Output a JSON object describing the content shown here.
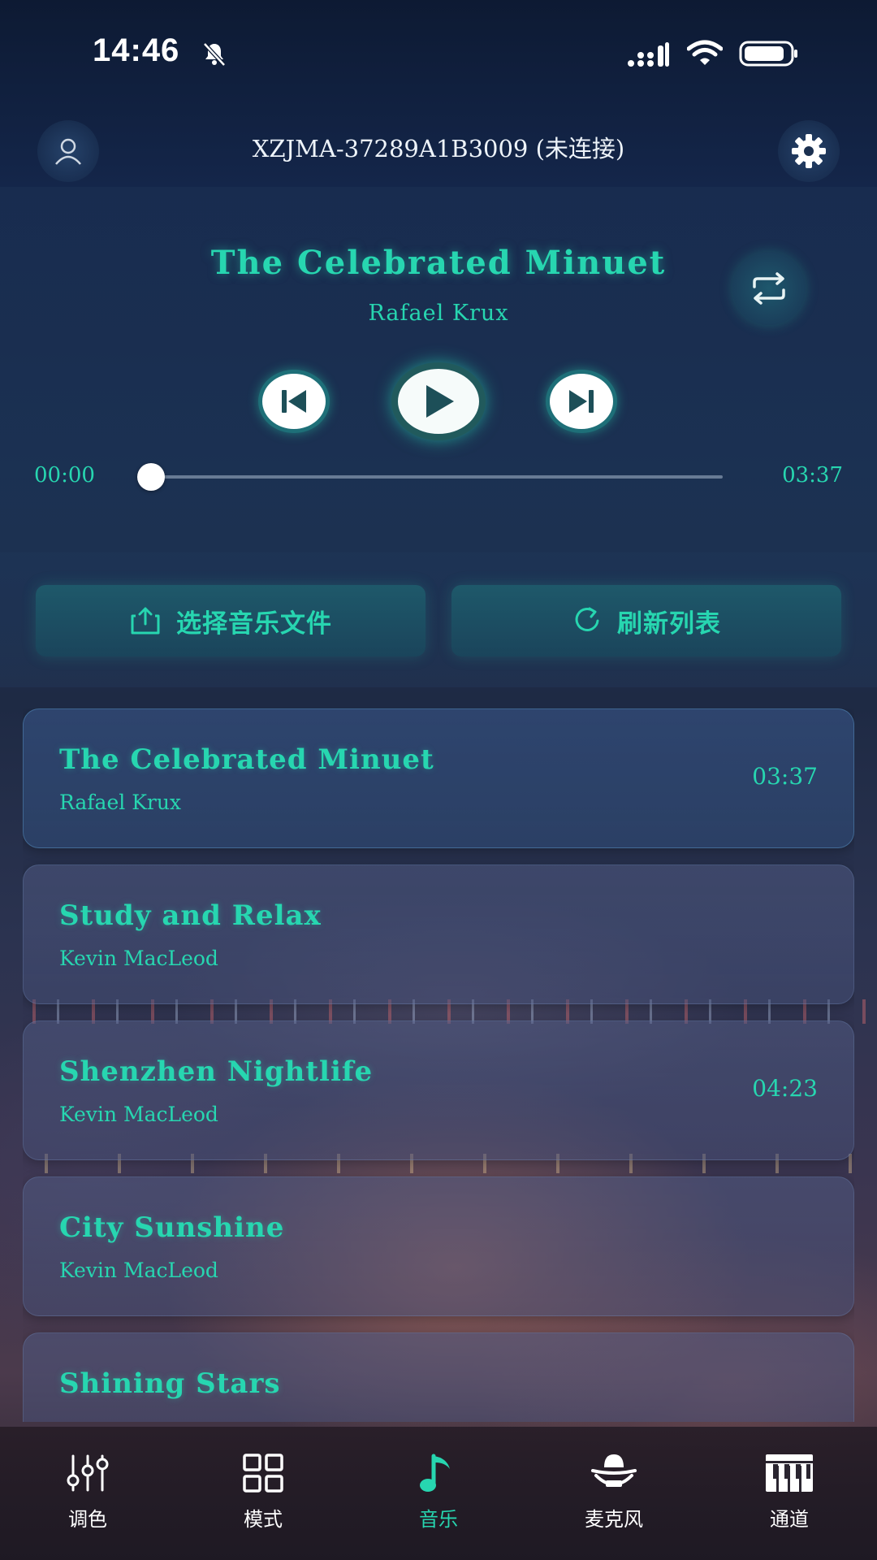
{
  "status_bar": {
    "time": "14:46"
  },
  "header": {
    "device_title": "XZJMA-37289A1B3009 (未连接)"
  },
  "player": {
    "track_title": "The Celebrated Minuet",
    "track_artist": "Rafael Krux",
    "time_current": "00:00",
    "time_total": "03:37",
    "progress": 0.0
  },
  "actions": {
    "select_file_label": "选择音乐文件",
    "refresh_label": "刷新列表"
  },
  "songs": [
    {
      "title": "The Celebrated Minuet",
      "artist": "Rafael Krux",
      "duration": "03:37"
    },
    {
      "title": "Study and Relax",
      "artist": "Kevin MacLeod",
      "duration": ""
    },
    {
      "title": "Shenzhen Nightlife",
      "artist": "Kevin MacLeod",
      "duration": "04:23"
    },
    {
      "title": "City Sunshine",
      "artist": "Kevin MacLeod",
      "duration": ""
    },
    {
      "title": "Shining Stars",
      "artist": "",
      "duration": ""
    }
  ],
  "tabs": [
    {
      "label": "调色",
      "icon": "sliders-icon"
    },
    {
      "label": "模式",
      "icon": "grid-icon"
    },
    {
      "label": "音乐",
      "icon": "music-note-icon"
    },
    {
      "label": "麦克风",
      "icon": "microphone-icon"
    },
    {
      "label": "通道",
      "icon": "piano-keys-icon"
    }
  ],
  "colors": {
    "accent": "#27d6b0",
    "background_top": "#0d1a33"
  }
}
